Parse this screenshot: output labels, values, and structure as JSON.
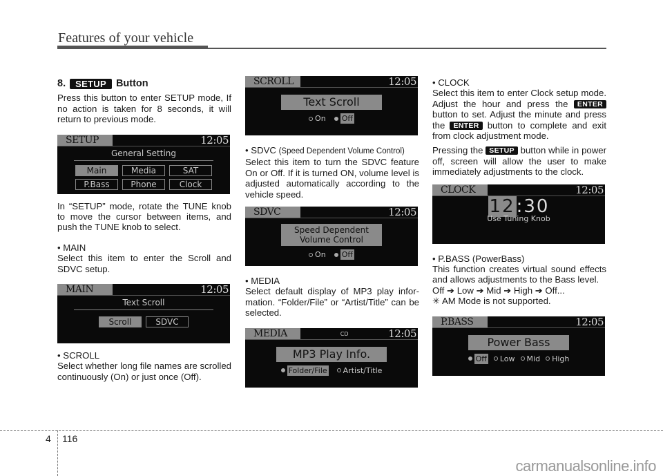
{
  "header": {
    "title": "Features of your vehicle"
  },
  "section": {
    "number": "8.",
    "key_label": "SETUP",
    "title_suffix": "Button",
    "intro": "Press this button to enter SETUP mode, If no action is taken for 8 seconds, it will return to previous mode.",
    "setup_note": "In “SETUP” mode, rotate the TUNE knob to move the cursor between items, and push the TUNE knob to select."
  },
  "screens": {
    "setup": {
      "mode": "SETUP",
      "time": "12:05",
      "subtitle": "General Setting",
      "items": [
        "Main",
        "Media",
        "SAT",
        "P.Bass",
        "Phone",
        "Clock"
      ],
      "selected": "Main"
    },
    "main": {
      "mode": "MAIN",
      "time": "12:05",
      "subtitle": "Text Scroll",
      "items": [
        "Scroll",
        "SDVC"
      ],
      "selected": "Scroll"
    },
    "scroll": {
      "mode": "SCROLL",
      "time": "12:05",
      "box": "Text Scroll",
      "options": [
        "On",
        "Off"
      ],
      "selected": "Off"
    },
    "sdvc": {
      "mode": "SDVC",
      "time": "12:05",
      "box_line1": "Speed Dependent",
      "box_line2": "Volume Control",
      "options": [
        "On",
        "Off"
      ],
      "selected": "Off"
    },
    "media": {
      "mode": "MEDIA",
      "mid": "CD",
      "time": "12:05",
      "box": "MP3 Play Info.",
      "options": [
        "Folder/File",
        "Artist/Title"
      ],
      "selected": "Folder/File"
    },
    "clock": {
      "mode": "CLOCK",
      "time": "12:05",
      "hour": "12",
      "sep": ":",
      "minute": "30",
      "hint": "Use Tuning Knob"
    },
    "pbass": {
      "mode": "P.BASS",
      "time": "12:05",
      "box": "Power Bass",
      "options": [
        "Off",
        "Low",
        "Mid",
        "High"
      ],
      "selected": "Off"
    }
  },
  "items": {
    "main": {
      "heading": "• MAIN",
      "text": "Select this item to enter the Scroll and SDVC setup."
    },
    "scroll": {
      "heading": "• SCROLL",
      "text": "Select whether long file names are scrolled continuously (On) or just once (Off)."
    },
    "sdvc": {
      "heading": "• SDVC",
      "heading_suffix": "(Speed Dependent Volume Control)",
      "text": "Select this item to turn the SDVC feature On or Off. If it is turned ON, volume level is adjusted automatically according to the vehicle speed."
    },
    "media": {
      "heading": "• MEDIA",
      "text": "Select default display of MP3 play infor-mation. “Folder/File” or “Artist/Title” can be selected."
    },
    "clock": {
      "heading": "• CLOCK",
      "text_a": "Select this item to enter Clock setup mode. Adjust the hour and press the",
      "key_enter": "ENTER",
      "text_b": "button to set. Adjust the minute and press the",
      "text_c": "button to complete and exit from clock adjustment mode.",
      "text_d": "Pressing the",
      "key_setup": "SETUP",
      "text_e": "button while in power off, screen will allow the user to make immediately adjustments to the clock."
    },
    "pbass": {
      "heading": "• P.BASS (PowerBass)",
      "text": "This function creates virtual sound effects and allows adjustments to the Bass level.",
      "cycle": "Off ➔ Low ➔ Mid ➔ High ➔ Off...",
      "note": "✳ AM Mode is not supported."
    }
  },
  "footer": {
    "chapter": "4",
    "page": "116",
    "watermark": "carmanualsonline.info"
  }
}
